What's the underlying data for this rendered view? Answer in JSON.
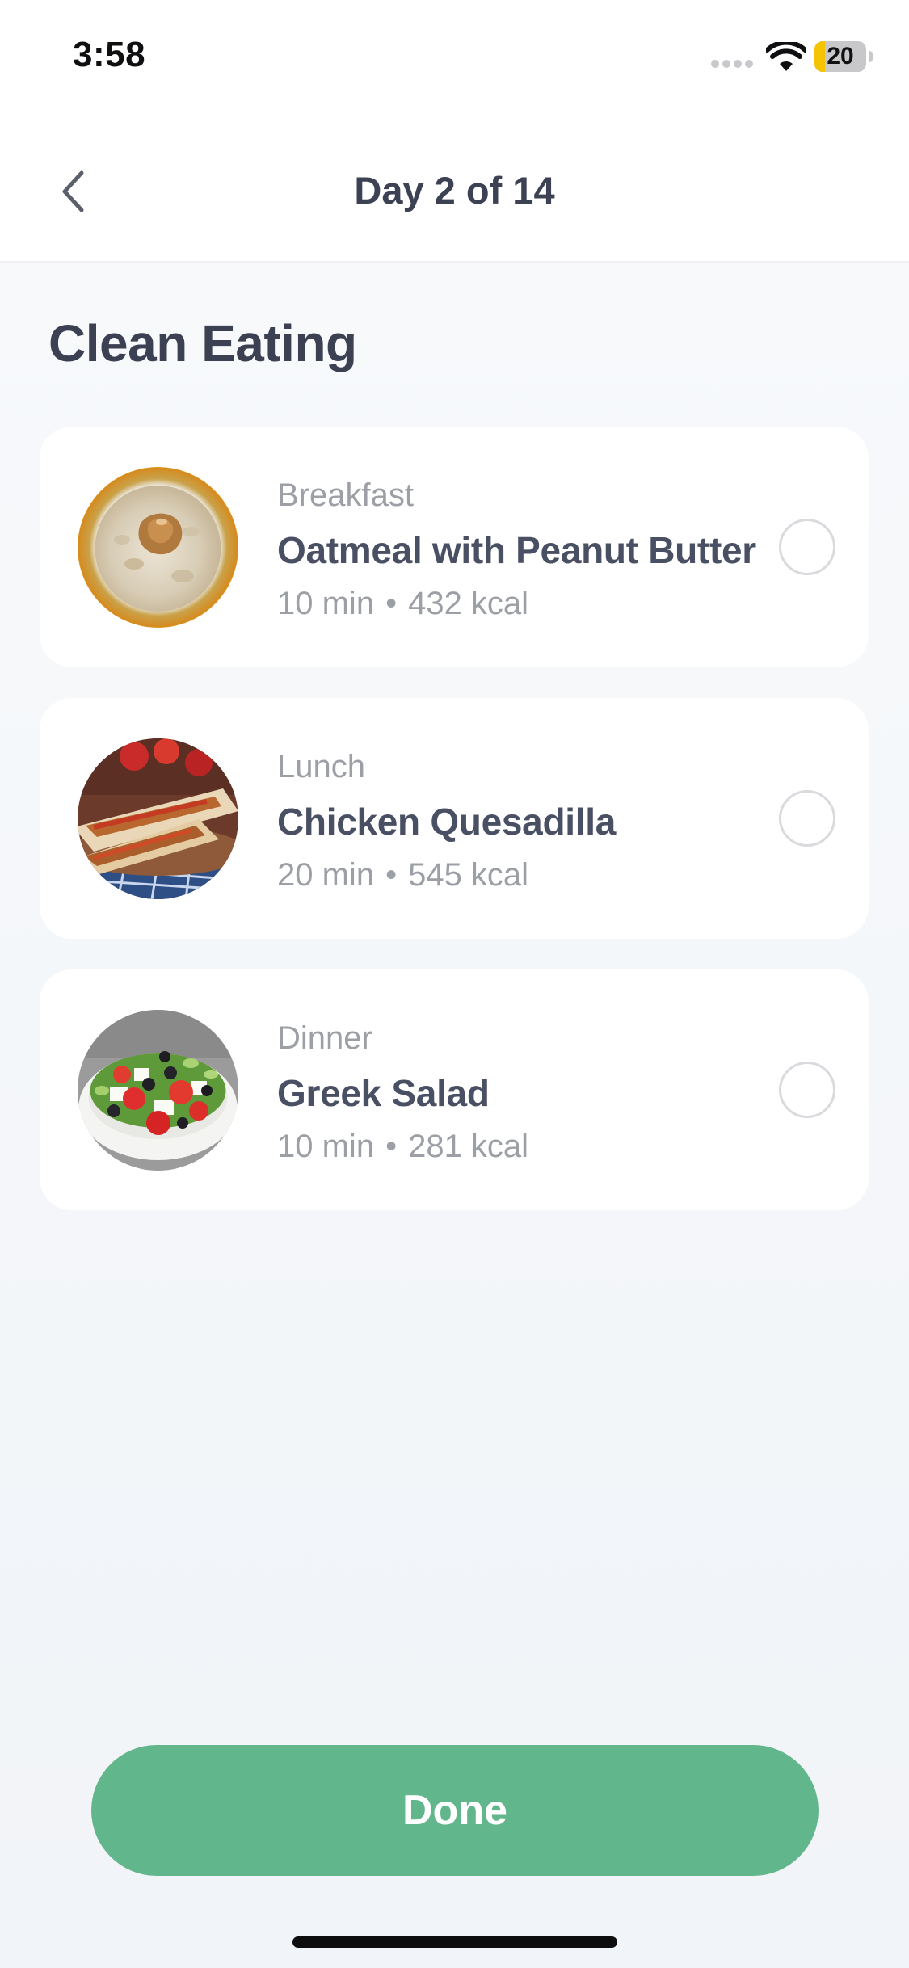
{
  "status_bar": {
    "time": "3:58",
    "battery_percent": 20,
    "battery_text": "20",
    "battery_color": "#f5c400"
  },
  "nav": {
    "back_icon": "chevron-left-icon",
    "title": "Day 2 of 14"
  },
  "plan": {
    "title": "Clean Eating"
  },
  "meals": [
    {
      "type": "Breakfast",
      "name": "Oatmeal with Peanut Butter",
      "time": "10 min",
      "separator": "•",
      "calories": "432 kcal",
      "completed": false
    },
    {
      "type": "Lunch",
      "name": "Chicken Quesadilla",
      "time": "20 min",
      "separator": "•",
      "calories": "545 kcal",
      "completed": false
    },
    {
      "type": "Dinner",
      "name": "Greek Salad",
      "time": "10 min",
      "separator": "•",
      "calories": "281 kcal",
      "completed": false
    }
  ],
  "done_button": {
    "label": "Done",
    "color": "#62b68b"
  }
}
